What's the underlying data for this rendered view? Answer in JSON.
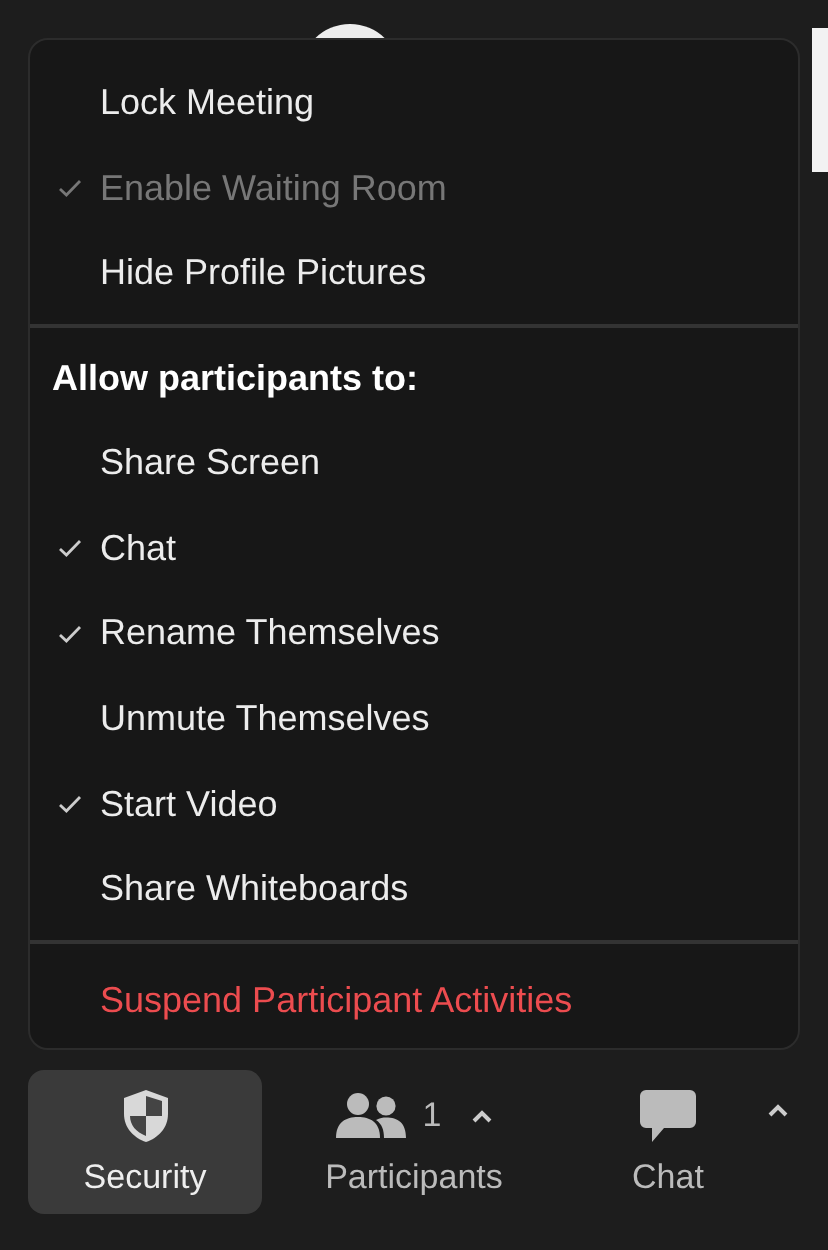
{
  "menu": {
    "items": [
      {
        "label": "Lock Meeting",
        "checked": false,
        "disabled": false
      },
      {
        "label": "Enable Waiting Room",
        "checked": true,
        "disabled": true
      },
      {
        "label": "Hide Profile Pictures",
        "checked": false,
        "disabled": false
      }
    ],
    "section_heading": "Allow participants to:",
    "participant_items": [
      {
        "label": "Share Screen",
        "checked": false,
        "disabled": false
      },
      {
        "label": "Chat",
        "checked": true,
        "disabled": false
      },
      {
        "label": "Rename Themselves",
        "checked": true,
        "disabled": false
      },
      {
        "label": "Unmute Themselves",
        "checked": false,
        "disabled": false
      },
      {
        "label": "Start Video",
        "checked": true,
        "disabled": false
      },
      {
        "label": "Share Whiteboards",
        "checked": false,
        "disabled": false
      }
    ],
    "danger_action": "Suspend Participant Activities"
  },
  "toolbar": [
    {
      "kind": "security",
      "label": "Security",
      "selected": true
    },
    {
      "kind": "participants",
      "label": "Participants",
      "count": "1",
      "selected": false
    },
    {
      "kind": "chat",
      "label": "Chat",
      "selected": false
    }
  ]
}
